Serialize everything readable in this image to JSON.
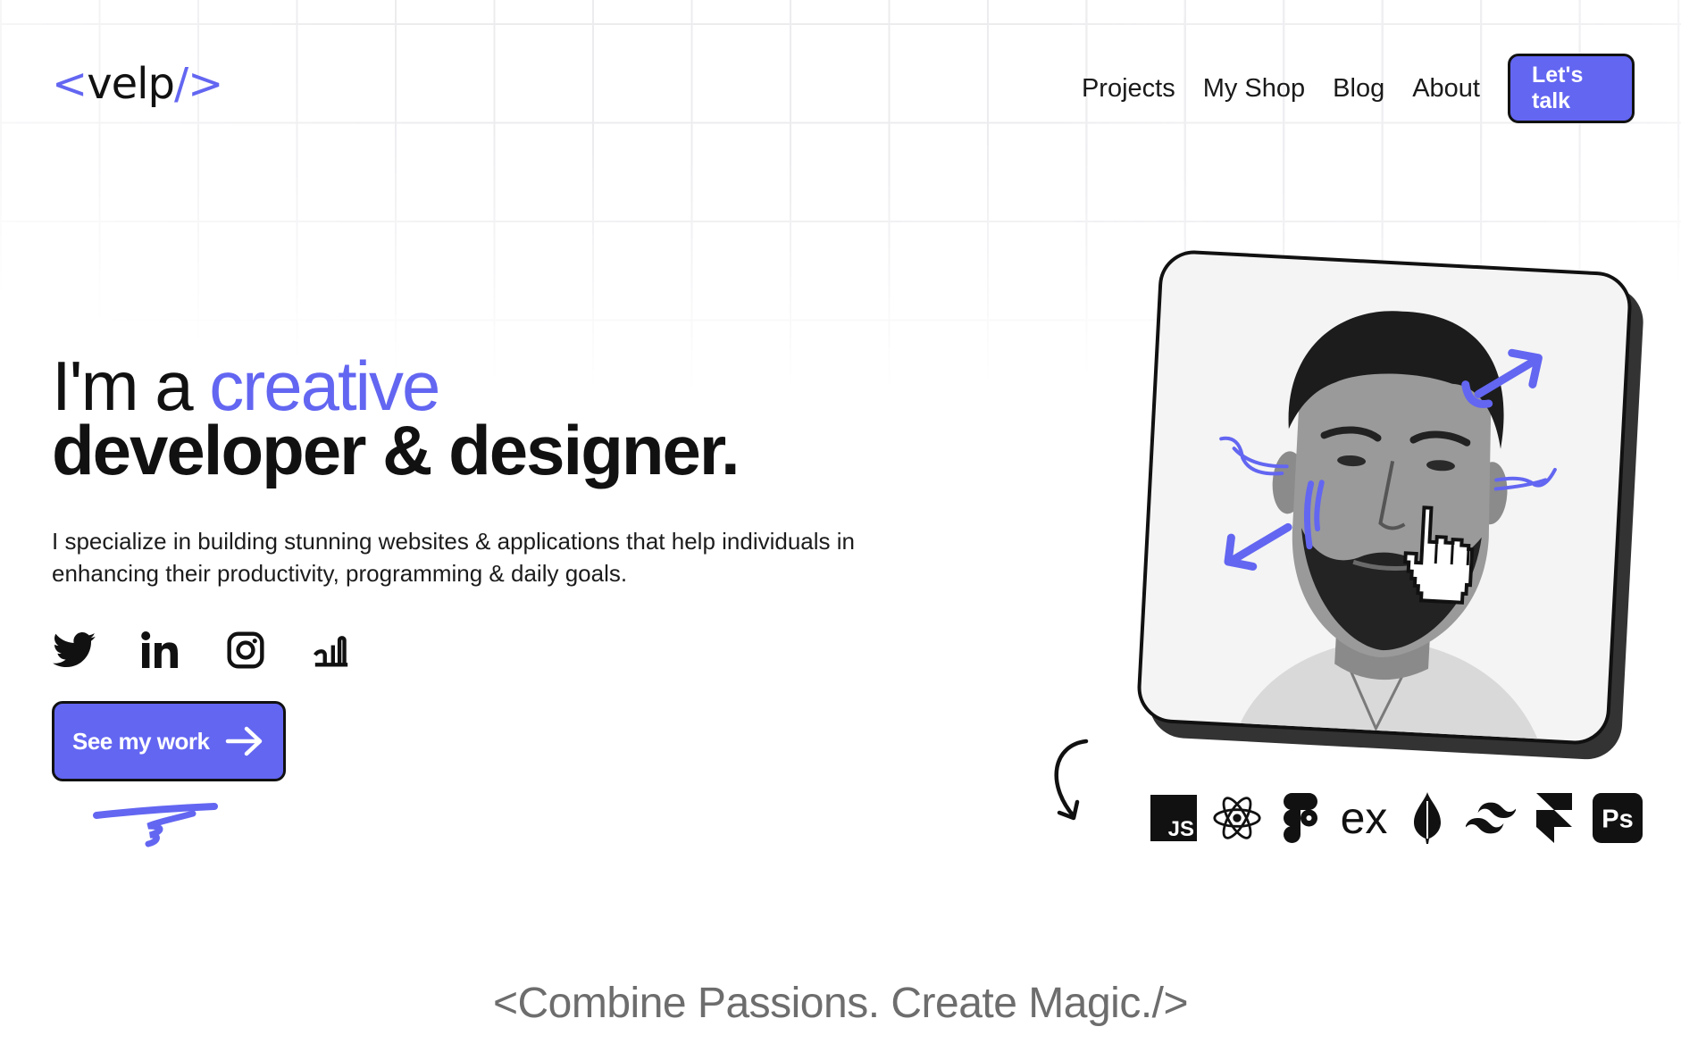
{
  "header": {
    "logo": {
      "open": "<",
      "name": "velp",
      "close": "/>"
    },
    "nav": [
      {
        "label": "Projects"
      },
      {
        "label": "My Shop"
      },
      {
        "label": "Blog"
      },
      {
        "label": "About"
      }
    ],
    "cta_label": "Let's talk"
  },
  "hero": {
    "headline_prefix": "I'm a ",
    "headline_accent": "creative",
    "headline_line2": "developer & designer.",
    "description": "I specialize in building stunning websites & applications that help individuals in enhancing their productivity, programming & daily goals.",
    "socials": [
      "twitter-icon",
      "linkedin-icon",
      "instagram-icon",
      "dev-blog-icon"
    ],
    "button_label": "See my work"
  },
  "tech_stack": [
    {
      "icon": "javascript-icon",
      "text": "JS"
    },
    {
      "icon": "react-icon"
    },
    {
      "icon": "figma-icon"
    },
    {
      "icon": "express-icon",
      "text": "ex"
    },
    {
      "icon": "mongodb-icon"
    },
    {
      "icon": "tailwind-icon"
    },
    {
      "icon": "framer-icon"
    },
    {
      "icon": "photoshop-icon",
      "text": "Ps"
    }
  ],
  "tagline": "<Combine Passions. Create Magic./>",
  "colors": {
    "accent": "#6366f1",
    "text": "#111111",
    "tagline": "#6d6d6d"
  }
}
